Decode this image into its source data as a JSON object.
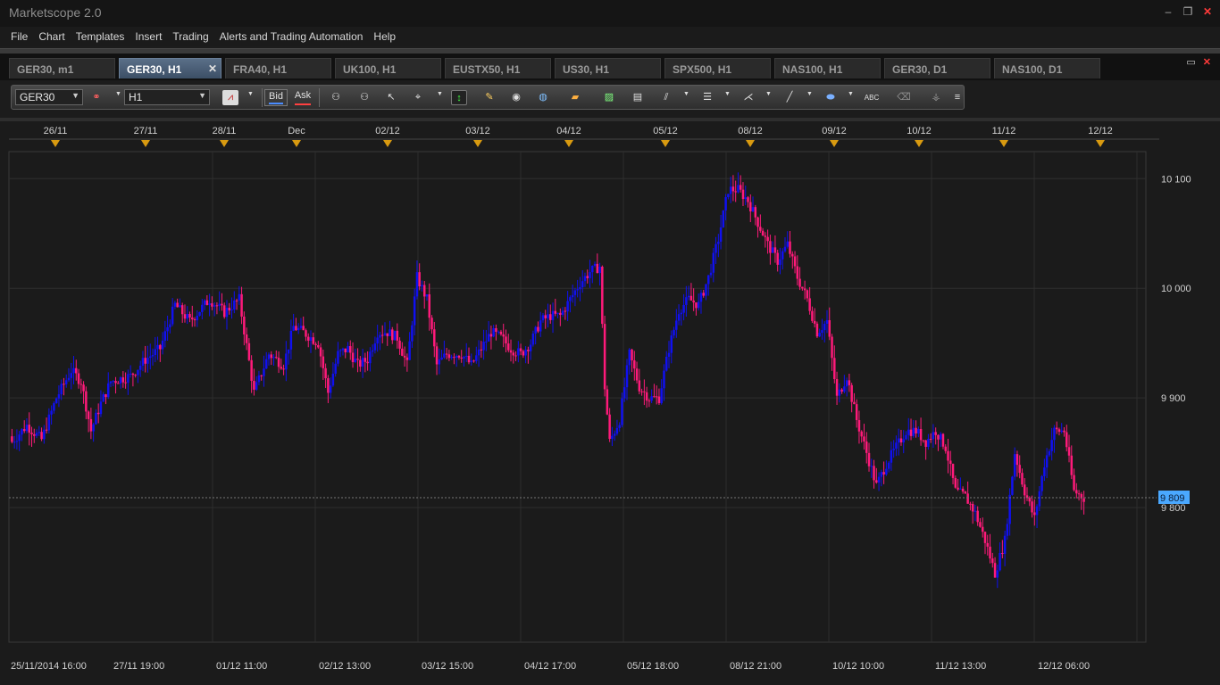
{
  "window": {
    "title": "Marketscope 2.0"
  },
  "menu": [
    "File",
    "Chart",
    "Templates",
    "Insert",
    "Trading",
    "Alerts and Trading Automation",
    "Help"
  ],
  "tabs": [
    {
      "label": "GER30, m1",
      "active": false
    },
    {
      "label": "GER30, H1",
      "active": true
    },
    {
      "label": "FRA40, H1",
      "active": false
    },
    {
      "label": "UK100, H1",
      "active": false
    },
    {
      "label": "EUSTX50, H1",
      "active": false
    },
    {
      "label": "US30, H1",
      "active": false
    },
    {
      "label": "SPX500, H1",
      "active": false
    },
    {
      "label": "NAS100, H1",
      "active": false
    },
    {
      "label": "GER30, D1",
      "active": false
    },
    {
      "label": "NAS100, D1",
      "active": false
    }
  ],
  "toolbar": {
    "instrument": "GER30",
    "timeframe": "H1",
    "bid_label": "Bid",
    "ask_label": "Ask",
    "icons": [
      "link-icon",
      "chart-type-icon",
      "zoom-in-icon",
      "zoom-out-icon",
      "cursor-icon",
      "crosshair-icon",
      "trade-icon",
      "edit-icon",
      "eye-icon",
      "globe-icon",
      "ruler-icon",
      "image-icon",
      "window-icon",
      "channel-icon",
      "levels-icon",
      "fan-icon",
      "line-icon",
      "ellipse-icon",
      "text-icon",
      "eraser-icon",
      "tree-icon",
      "menu-icon"
    ]
  },
  "colors": {
    "bull": "#1010f0",
    "bear": "#ff1a7a",
    "background": "#1b1b1b",
    "grid": "#2e2e2e",
    "price_tag": "#4aa8ff",
    "marker": "#d89a10"
  },
  "chart_data": {
    "type": "candlestick",
    "symbol": "GER30",
    "timeframe": "H1",
    "top_axis_labels": [
      "26/11",
      "27/11",
      "28/11",
      "Dec",
      "02/12",
      "03/12",
      "04/12",
      "05/12",
      "08/12",
      "09/12",
      "10/12",
      "11/12",
      "12/12"
    ],
    "bottom_axis_labels": [
      "25/11/2014 16:00",
      "27/11 19:00",
      "01/12 11:00",
      "02/12 13:00",
      "03/12 15:00",
      "04/12 17:00",
      "05/12 18:00",
      "08/12 21:00",
      "10/12 10:00",
      "11/12 13:00",
      "12/12 06:00"
    ],
    "y_ticks": [
      9800,
      9900,
      10000,
      10100
    ],
    "y_tick_labels": [
      "9 800",
      "9 900",
      "10 000",
      "10 100"
    ],
    "ylim": [
      9700,
      10110
    ],
    "current_price": 9809,
    "current_price_label": "9 809",
    "close_path": [
      [
        0,
        9860
      ],
      [
        3,
        9875
      ],
      [
        6,
        9862
      ],
      [
        9,
        9900
      ],
      [
        12,
        9925
      ],
      [
        14,
        9915
      ],
      [
        16,
        9870
      ],
      [
        18,
        9895
      ],
      [
        20,
        9915
      ],
      [
        24,
        9920
      ],
      [
        27,
        9935
      ],
      [
        30,
        9945
      ],
      [
        33,
        9985
      ],
      [
        36,
        9970
      ],
      [
        40,
        9990
      ],
      [
        43,
        9978
      ],
      [
        46,
        9990
      ],
      [
        49,
        9905
      ],
      [
        52,
        9940
      ],
      [
        55,
        9930
      ],
      [
        57,
        9965
      ],
      [
        59,
        9960
      ],
      [
        62,
        9950
      ],
      [
        64,
        9905
      ],
      [
        66,
        9940
      ],
      [
        68,
        9945
      ],
      [
        70,
        9930
      ],
      [
        72,
        9935
      ],
      [
        74,
        9960
      ],
      [
        76,
        9960
      ],
      [
        78,
        9955
      ],
      [
        80,
        9930
      ],
      [
        82,
        10010
      ],
      [
        84,
        9990
      ],
      [
        86,
        9930
      ],
      [
        88,
        9940
      ],
      [
        91,
        9940
      ],
      [
        93,
        9930
      ],
      [
        95,
        9945
      ],
      [
        97,
        9960
      ],
      [
        99,
        9955
      ],
      [
        101,
        9945
      ],
      [
        103,
        9940
      ],
      [
        105,
        9950
      ],
      [
        107,
        9970
      ],
      [
        109,
        9975
      ],
      [
        111,
        9975
      ],
      [
        113,
        9990
      ],
      [
        115,
        10005
      ],
      [
        117,
        10015
      ],
      [
        119,
        10020
      ],
      [
        120,
        9910
      ],
      [
        121,
        9860
      ],
      [
        123,
        9880
      ],
      [
        125,
        9940
      ],
      [
        127,
        9910
      ],
      [
        129,
        9900
      ],
      [
        131,
        9900
      ],
      [
        133,
        9945
      ],
      [
        135,
        9980
      ],
      [
        137,
        9990
      ],
      [
        139,
        9985
      ],
      [
        141,
        10010
      ],
      [
        143,
        10045
      ],
      [
        145,
        10090
      ],
      [
        147,
        10090
      ],
      [
        149,
        10080
      ],
      [
        151,
        10060
      ],
      [
        153,
        10040
      ],
      [
        155,
        10025
      ],
      [
        157,
        10040
      ],
      [
        159,
        10010
      ],
      [
        161,
        9990
      ],
      [
        163,
        9960
      ],
      [
        165,
        9970
      ],
      [
        167,
        9900
      ],
      [
        169,
        9920
      ],
      [
        171,
        9880
      ],
      [
        173,
        9850
      ],
      [
        175,
        9820
      ],
      [
        177,
        9840
      ],
      [
        179,
        9855
      ],
      [
        181,
        9870
      ],
      [
        183,
        9870
      ],
      [
        185,
        9860
      ],
      [
        187,
        9870
      ],
      [
        189,
        9855
      ],
      [
        191,
        9815
      ],
      [
        193,
        9810
      ],
      [
        195,
        9795
      ],
      [
        197,
        9770
      ],
      [
        199,
        9740
      ],
      [
        201,
        9770
      ],
      [
        203,
        9850
      ],
      [
        205,
        9815
      ],
      [
        207,
        9790
      ],
      [
        209,
        9840
      ],
      [
        211,
        9870
      ],
      [
        213,
        9870
      ],
      [
        215,
        9815
      ],
      [
        217,
        9809
      ]
    ]
  }
}
